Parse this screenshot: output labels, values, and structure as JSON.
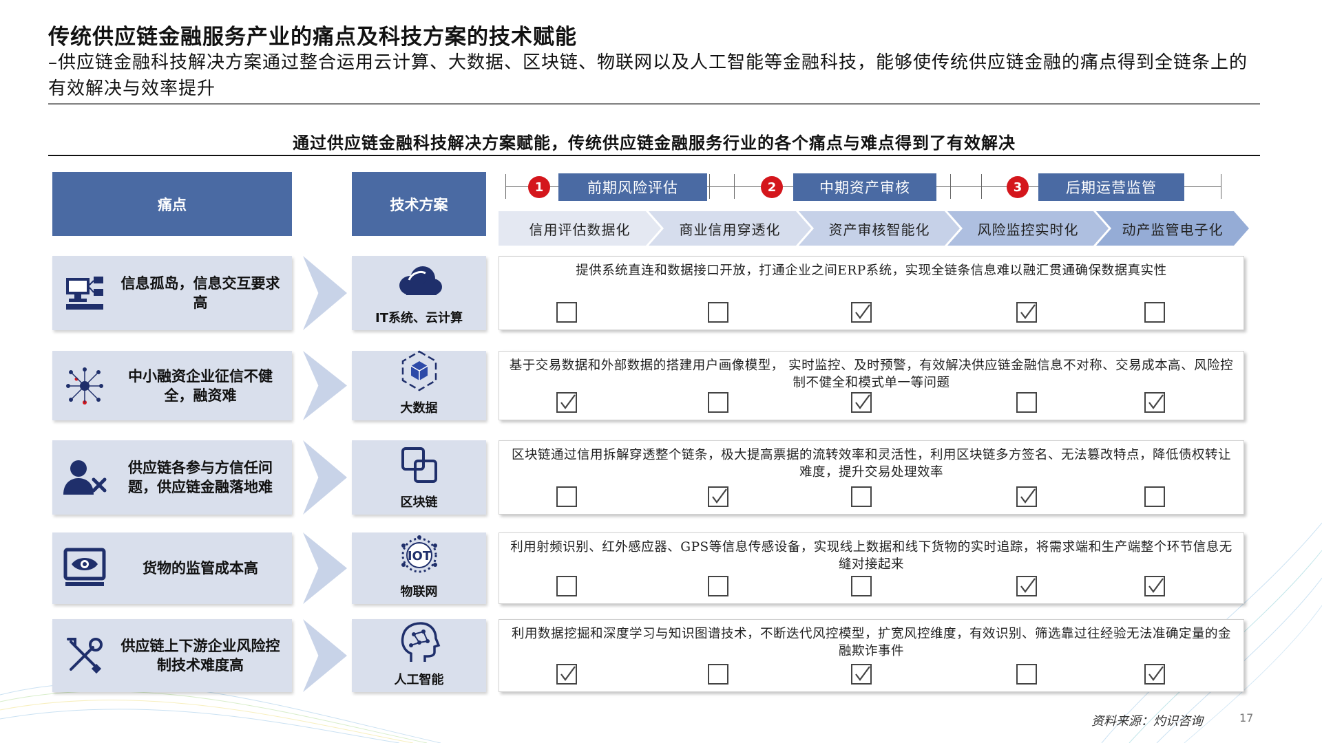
{
  "header": {
    "title": "传统供应链金融服务产业的痛点及科技方案的技术赋能",
    "subtitle": "–供应链金融科技解决方案通过整合运用云计算、大数据、区块链、物联网以及人工智能等金融科技，能够使传统供应链金融的痛点得到全链条上的有效解决与效率提升"
  },
  "section_title": "通过供应链金融科技解决方案赋能，传统供应链金融服务行业的各个痛点与难点得到了有效解决",
  "columns": {
    "pain_header": "痛点",
    "tech_header": "技术方案"
  },
  "phases": [
    {
      "num": "1",
      "label": "前期风险评估"
    },
    {
      "num": "2",
      "label": "中期资产审核"
    },
    {
      "num": "3",
      "label": "后期运营监管"
    }
  ],
  "stages": [
    "信用评估数据化",
    "商业信用穿透化",
    "资产审核智能化",
    "风险监控实时化",
    "动产监管电子化"
  ],
  "stage_colors": [
    "#e4e8f2",
    "#d6dded",
    "#c6d1e8",
    "#aebfe0",
    "#95acd6"
  ],
  "rows": [
    {
      "pain": "信息孤岛，信息交互要求高",
      "pain_icon": "computer-network-icon",
      "tech": "IT系统、云计算",
      "tech_icon": "cloud-icon",
      "solution": "提供系统直连和数据接口开放，打通企业之间ERP系统，实现全链条信息难以融汇贯通确保数据真实性",
      "checks": [
        false,
        false,
        true,
        true,
        false
      ]
    },
    {
      "pain": "中小融资企业征信不健全，融资难",
      "pain_icon": "data-network-icon",
      "tech": "大数据",
      "tech_icon": "data-cube-icon",
      "solution": "基于交易数据和外部数据的搭建用户画像模型， 实时监控、及时预警，有效解决供应链金融信息不对称、交易成本高、风险控制不健全和模式单一等问题",
      "checks": [
        true,
        false,
        true,
        false,
        true
      ]
    },
    {
      "pain": "供应链各参与方信任问题，供应链金融落地难",
      "pain_icon": "user-remove-icon",
      "tech": "区块链",
      "tech_icon": "blockchain-icon",
      "solution": "区块链通过信用拆解穿透整个链条，极大提高票据的流转效率和灵活性，利用区块链多方签名、无法篡改特点，降低债权转让难度，提升交易处理效率",
      "checks": [
        false,
        true,
        false,
        true,
        false
      ]
    },
    {
      "pain": "货物的监管成本高",
      "pain_icon": "monitor-eye-icon",
      "tech": "物联网",
      "tech_icon": "iot-icon",
      "solution": "利用射频识别、红外感应器、GPS等信息传感设备，实现线上数据和线下货物的实时追踪，将需求端和生产端整个环节信息无缝对接起来",
      "checks": [
        false,
        false,
        false,
        true,
        true
      ]
    },
    {
      "pain": "供应链上下游企业风险控制技术难度高",
      "pain_icon": "tools-icon",
      "tech": "人工智能",
      "tech_icon": "ai-head-icon",
      "solution": "利用数据挖掘和深度学习与知识图谱技术，不断迭代风控模型，扩宽风控维度，有效识别、筛选靠过往经验无法准确定量的金融欺诈事件",
      "checks": [
        true,
        false,
        true,
        false,
        true
      ]
    }
  ],
  "footer": {
    "source": "资料来源：灼识咨询",
    "page": "17"
  },
  "colors": {
    "header_blue": "#4a6aa3",
    "light_blue": "#d9dfec",
    "badge_red": "#d4161c",
    "icon_navy": "#1f2f6b"
  }
}
